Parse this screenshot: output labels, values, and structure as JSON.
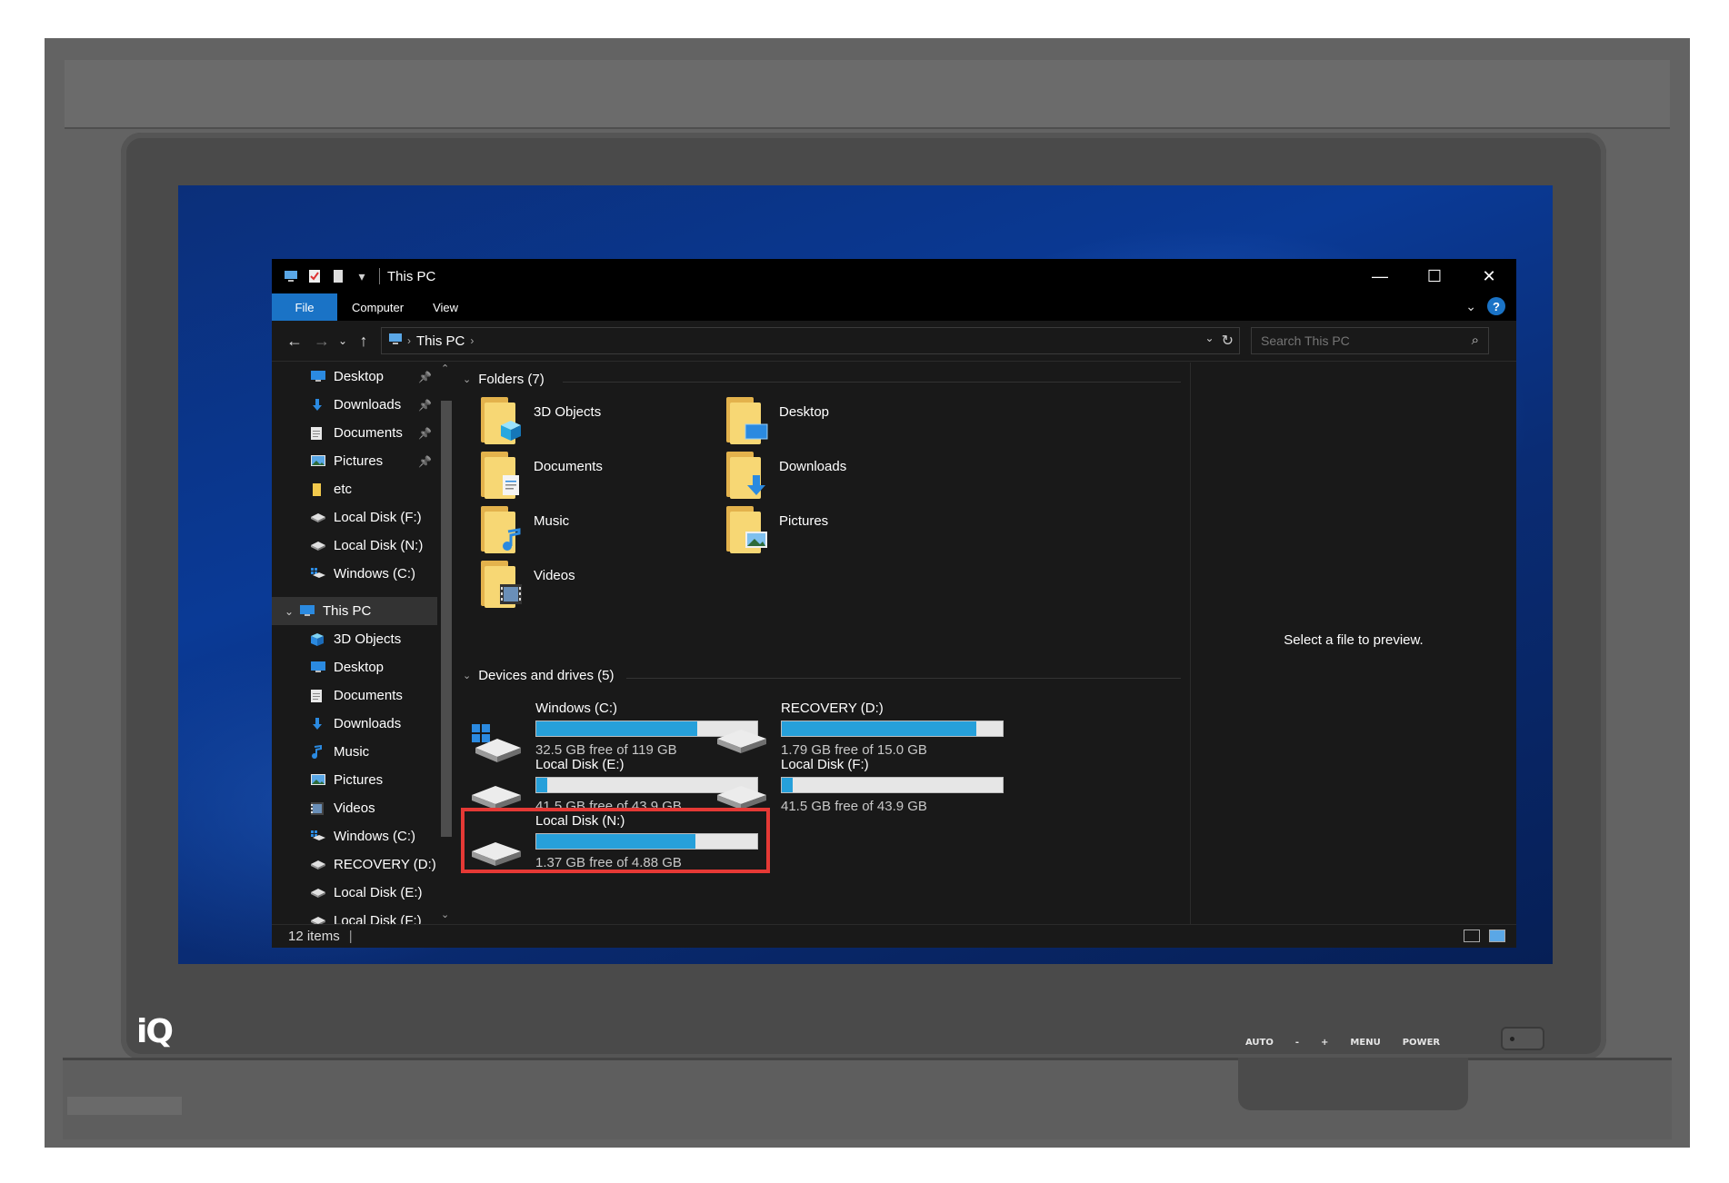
{
  "window": {
    "title": "This PC",
    "tabs": [
      "File",
      "Computer",
      "View"
    ]
  },
  "navigation": {
    "breadcrumb": "This PC",
    "search_placeholder": "Search This PC"
  },
  "sidebar": {
    "quick_access": [
      {
        "label": "Desktop",
        "icon": "desktop-icon",
        "pinned": true
      },
      {
        "label": "Downloads",
        "icon": "download-arrow-icon",
        "pinned": true
      },
      {
        "label": "Documents",
        "icon": "documents-icon",
        "pinned": true
      },
      {
        "label": "Pictures",
        "icon": "pictures-icon",
        "pinned": true
      },
      {
        "label": "etc",
        "icon": "folder-icon",
        "pinned": false
      },
      {
        "label": "Local Disk (F:)",
        "icon": "drive-icon",
        "pinned": false
      },
      {
        "label": "Local Disk (N:)",
        "icon": "drive-icon",
        "pinned": false
      },
      {
        "label": "Windows (C:)",
        "icon": "windows-drive-icon",
        "pinned": false
      }
    ],
    "this_pc_label": "This PC",
    "this_pc_children": [
      {
        "label": "3D Objects",
        "icon": "3d-objects-icon"
      },
      {
        "label": "Desktop",
        "icon": "desktop-icon"
      },
      {
        "label": "Documents",
        "icon": "documents-icon"
      },
      {
        "label": "Downloads",
        "icon": "download-arrow-icon"
      },
      {
        "label": "Music",
        "icon": "music-note-icon"
      },
      {
        "label": "Pictures",
        "icon": "pictures-icon"
      },
      {
        "label": "Videos",
        "icon": "videos-icon"
      },
      {
        "label": "Windows (C:)",
        "icon": "windows-drive-icon"
      },
      {
        "label": "RECOVERY (D:)",
        "icon": "drive-icon"
      },
      {
        "label": "Local Disk (E:)",
        "icon": "drive-icon"
      },
      {
        "label": "Local Disk (F:)",
        "icon": "drive-icon"
      }
    ]
  },
  "folders": {
    "header": "Folders (7)",
    "items": [
      {
        "name": "3D Objects",
        "emblem": "3d-cube"
      },
      {
        "name": "Desktop",
        "emblem": "desktop"
      },
      {
        "name": "Documents",
        "emblem": "document"
      },
      {
        "name": "Downloads",
        "emblem": "download"
      },
      {
        "name": "Music",
        "emblem": "music"
      },
      {
        "name": "Pictures",
        "emblem": "picture"
      },
      {
        "name": "Videos",
        "emblem": "video"
      }
    ]
  },
  "drives": {
    "header": "Devices and drives (5)",
    "items": [
      {
        "name": "Windows (C:)",
        "info": "32.5 GB free of 119 GB",
        "used_fraction": 0.73,
        "icon": "windows-drive-icon",
        "highlighted": false
      },
      {
        "name": "RECOVERY (D:)",
        "info": "1.79 GB free of 15.0 GB",
        "used_fraction": 0.88,
        "icon": "drive-icon",
        "highlighted": false
      },
      {
        "name": "Local Disk (E:)",
        "info": "41.5 GB free of 43.9 GB",
        "used_fraction": 0.05,
        "icon": "drive-icon",
        "highlighted": false
      },
      {
        "name": "Local Disk (F:)",
        "info": "41.5 GB free of 43.9 GB",
        "used_fraction": 0.05,
        "icon": "drive-icon",
        "highlighted": false
      },
      {
        "name": "Local Disk (N:)",
        "info": "1.37 GB free of 4.88 GB",
        "used_fraction": 0.72,
        "icon": "drive-icon",
        "highlighted": true
      }
    ]
  },
  "preview": {
    "text": "Select a file to preview."
  },
  "status": {
    "item_count": "12 items"
  },
  "monitor": {
    "brand": "iQ",
    "buttons": [
      "AUTO",
      "-",
      "+",
      "MENU",
      "POWER"
    ]
  },
  "colors": {
    "accent": "#1a73c6",
    "drive_fill": "#26a0da",
    "highlight": "#e53935",
    "window_bg": "#191919"
  }
}
